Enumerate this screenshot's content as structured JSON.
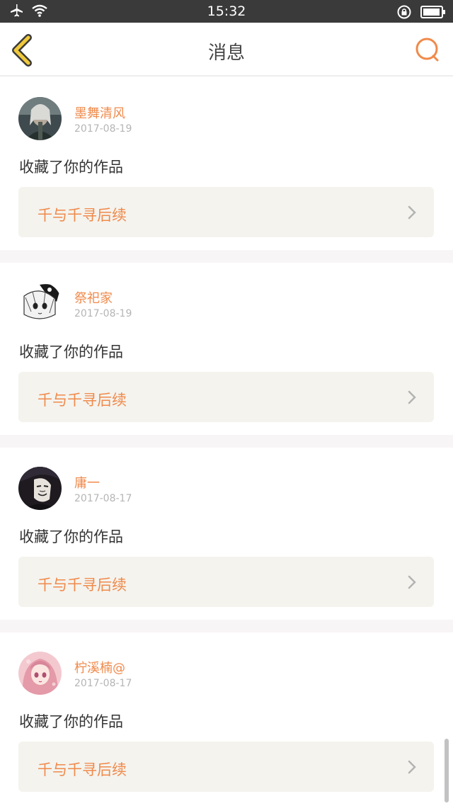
{
  "status_bar": {
    "time": "15:32"
  },
  "header": {
    "title": "消息",
    "back_icon": "chevron-left-icon",
    "search_icon": "search-icon"
  },
  "colors": {
    "accent": "#f08a4b",
    "card_bg": "#f4f3ee",
    "separator": "#f8f5f6",
    "back_icon": "#f0c93c"
  },
  "messages": [
    {
      "user": "墨舞清风",
      "date": "2017-08-19",
      "action": "收藏了你的作品",
      "work": "千与千寻后续",
      "avatar": "avatar-dark-warrior"
    },
    {
      "user": "祭祀家",
      "date": "2017-08-19",
      "action": "收藏了你的作品",
      "work": "千与千寻后续",
      "avatar": "avatar-manga-girl"
    },
    {
      "user": "庸一",
      "date": "2017-08-17",
      "action": "收藏了你的作品",
      "work": "千与千寻后续",
      "avatar": "avatar-mask"
    },
    {
      "user": "柠溪楠@",
      "date": "2017-08-17",
      "action": "收藏了你的作品",
      "work": "千与千寻后续",
      "avatar": "avatar-pink-anime"
    }
  ]
}
